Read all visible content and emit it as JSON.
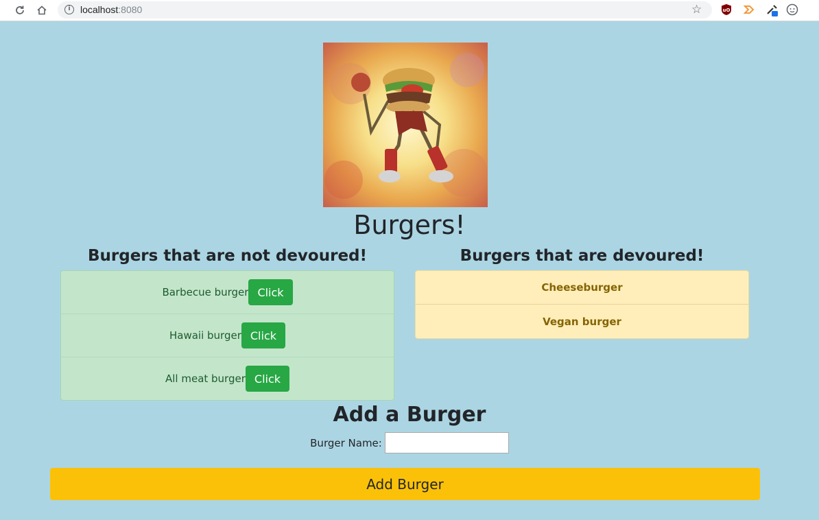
{
  "browser": {
    "url_host": "localhost",
    "url_port": ":8080",
    "icons": [
      "reload-icon",
      "home-icon",
      "info-icon",
      "star-icon",
      "ublock-icon",
      "play-icon",
      "eyedropper-icon",
      "profile-icon"
    ]
  },
  "page": {
    "title": "Burgers!"
  },
  "not_devoured": {
    "heading": "Burgers that are not devoured!",
    "button_label": "Click",
    "items": [
      {
        "name": "Barbecue burger"
      },
      {
        "name": "Hawaii burger"
      },
      {
        "name": "All meat burger"
      }
    ]
  },
  "devoured": {
    "heading": "Burgers that are devoured!",
    "items": [
      {
        "name": "Cheeseburger"
      },
      {
        "name": "Vegan burger"
      }
    ]
  },
  "form": {
    "heading": "Add a Burger",
    "label": "Burger Name:",
    "input_value": "",
    "submit_label": "Add Burger"
  },
  "colors": {
    "background": "#acd5e3",
    "success_list": "#c3e6cb",
    "warning_list": "#ffeeba",
    "click_button": "#28a745",
    "add_button": "#fbc108"
  }
}
